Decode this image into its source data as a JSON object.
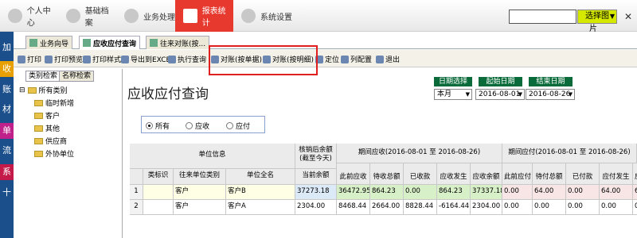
{
  "topnav": {
    "items": [
      {
        "label": "个人中心",
        "icon": "user-icon"
      },
      {
        "label": "基础档案",
        "icon": "archive-icon"
      },
      {
        "label": "业务处理",
        "icon": "business-icon"
      },
      {
        "label": "报表统计",
        "icon": "report-icon",
        "active": true
      },
      {
        "label": "系统设置",
        "icon": "gear-icon"
      }
    ],
    "search_value": "",
    "pick_button": "选择图片",
    "close": "✕"
  },
  "leftbar": [
    "加",
    "收",
    "账",
    "材",
    "单",
    "流",
    "系",
    "十"
  ],
  "tabs": [
    {
      "label": "业务向导"
    },
    {
      "label": "应收应付查询",
      "active": true
    },
    {
      "label": "往来对账(按..."
    }
  ],
  "toolbar": [
    "打印",
    "打印预览",
    "打印样式",
    "导出到EXCEL",
    "执行查询",
    "对账(按单据)",
    "对账(按明细)",
    "定位",
    "列配置",
    "退出"
  ],
  "tree": {
    "tabs": [
      "类别检索",
      "名称检索"
    ],
    "nodes": [
      "所有类别",
      "临时新增",
      "客户",
      "其他",
      "供应商",
      "外协单位"
    ]
  },
  "main": {
    "title": "应收应付查询",
    "date_labels": [
      "日期选择",
      "起始日期",
      "结束日期"
    ],
    "date_values": [
      "本月",
      "2016-08-01",
      "2016-08-26"
    ],
    "radios": [
      "所有",
      "应收",
      "应付"
    ]
  },
  "grid": {
    "group_headers": [
      "单位信息",
      "核销后余额\n(截至今天)",
      "期间应收(2016-08-01 至 2016-08-26)",
      "期间应付(2016-08-01 至 2016-08-26)"
    ],
    "columns": [
      "类标识",
      "往来单位类别",
      "单位全名",
      "当前余额",
      "此前应收",
      "待收总额",
      "已收款",
      "应收发生",
      "应收余额",
      "此前应付",
      "待付总额",
      "已付款",
      "应付发生",
      "应"
    ],
    "rows": [
      [
        "1",
        "",
        "客户",
        "客户B",
        "37273.18",
        "36472.95",
        "864.23",
        "0.00",
        "864.23",
        "37337.18",
        "0.00",
        "64.00",
        "0.00",
        "64.00",
        "6"
      ],
      [
        "2",
        "",
        "客户",
        "客户A",
        "2304.00",
        "8468.44",
        "2664.00",
        "8828.44",
        "-6164.44",
        "2304.00",
        "0.00",
        "0.00",
        "0.00",
        "0.00",
        "0"
      ]
    ]
  },
  "colors": {
    "accent_red": "#e8392f",
    "nav_blue": "#1b4f8c",
    "date_green": "#0a6b3a",
    "pick_yellow": "#d4e800"
  }
}
